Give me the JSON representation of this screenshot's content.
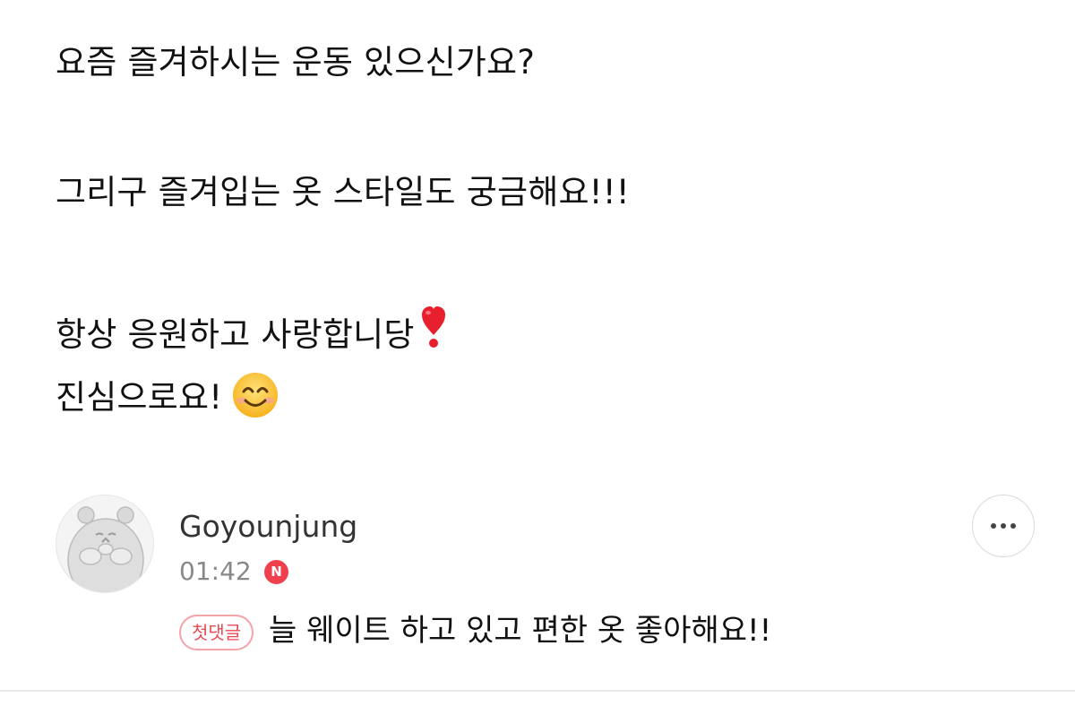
{
  "post": {
    "line1": "요즘 즐겨하시는 운동 있으신가요?",
    "line2": "그리구 즐겨입는 옷 스타일도 궁금해요!!!",
    "line3": "항상 응원하고 사랑합니당",
    "line4": "진심으로요!",
    "emojis": [
      "red-exclamation-heart-emoji",
      "smiling-face-emoji"
    ]
  },
  "comment": {
    "author": "Goyounjung",
    "time": "01:42",
    "new_badge": "N",
    "first_comment_badge": "첫댓글",
    "text": "늘 웨이트 하고 있고 편한 옷 좋아해요!!",
    "more_icon": "more-dots-icon",
    "avatar_icon": "hamster-avatar"
  },
  "colors": {
    "badge_red": "#f0404e",
    "first_comment_border": "#f4a3a8",
    "first_comment_text": "#e94a55",
    "muted_text": "#888888",
    "divider": "#e8e8e8"
  }
}
